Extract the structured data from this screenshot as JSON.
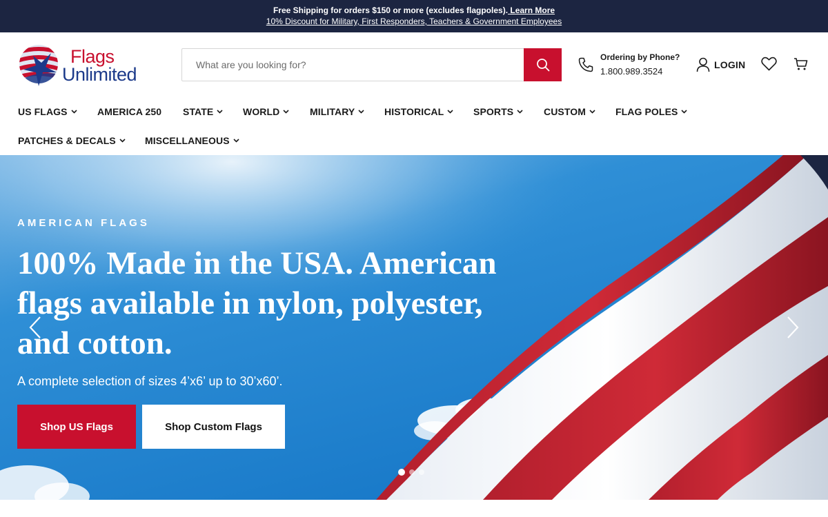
{
  "announcement": {
    "line1_text": "Free Shipping for orders $150 or more (excludes flagpoles).",
    "line1_link": " Learn More",
    "line2_link": "10% Discount for Military, First Responders, Teachers & Government Employees"
  },
  "header": {
    "logo_word1": "Flags",
    "logo_word2": "Unlimited",
    "search_placeholder": "What are you looking for?",
    "phone_label": "Ordering by Phone?",
    "phone_number": "1.800.989.3524",
    "login_label": "LOGIN"
  },
  "nav": {
    "items": [
      {
        "label": "US FLAGS"
      },
      {
        "label": "AMERICA 250"
      },
      {
        "label": "STATE"
      },
      {
        "label": "WORLD"
      },
      {
        "label": "MILITARY"
      },
      {
        "label": "HISTORICAL"
      },
      {
        "label": "SPORTS"
      },
      {
        "label": "CUSTOM"
      },
      {
        "label": "FLAG POLES"
      },
      {
        "label": "PATCHES & DECALS"
      },
      {
        "label": "MISCELLANEOUS"
      }
    ]
  },
  "hero": {
    "eyebrow": "AMERICAN FLAGS",
    "headline": "100% Made in the USA. American flags available in nylon, polyester, and cotton.",
    "subtext": "A complete selection of sizes 4’x6’ up to 30’x60’.",
    "primary_button": "Shop US Flags",
    "secondary_button": "Shop Custom Flags",
    "slide_count": 3,
    "active_slide": 1
  },
  "colors": {
    "announcement_bg": "#1c2541",
    "brand_red": "#c8102e",
    "brand_blue": "#1c3a8a",
    "sky": "#2f8fd6"
  },
  "icons": [
    "search-icon",
    "phone-icon",
    "user-icon",
    "heart-icon",
    "cart-icon",
    "chevron-down-icon",
    "chevron-left-icon",
    "chevron-right-icon"
  ]
}
